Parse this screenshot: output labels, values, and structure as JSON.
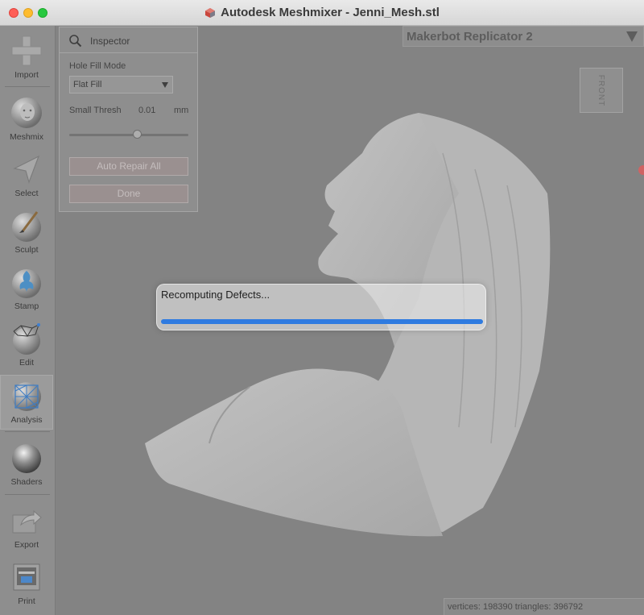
{
  "window": {
    "title": "Autodesk Meshmixer - Jenni_Mesh.stl"
  },
  "toolbar": {
    "tools": [
      {
        "label": "Import",
        "icon": "plus-icon"
      },
      {
        "label": "Meshmix",
        "icon": "head-sphere-icon"
      },
      {
        "label": "Select",
        "icon": "arrow-cursor-icon"
      },
      {
        "label": "Sculpt",
        "icon": "brush-sphere-icon"
      },
      {
        "label": "Stamp",
        "icon": "stamp-sphere-icon"
      },
      {
        "label": "Edit",
        "icon": "wireframe-sphere-icon"
      },
      {
        "label": "Analysis",
        "icon": "analysis-mesh-icon"
      },
      {
        "label": "Shaders",
        "icon": "shaded-sphere-icon"
      },
      {
        "label": "Export",
        "icon": "export-arrow-icon"
      },
      {
        "label": "Print",
        "icon": "printer-icon"
      }
    ],
    "active": "Analysis"
  },
  "printer": {
    "name": "Makerbot Replicator 2"
  },
  "viewcube": {
    "face": "FRONT"
  },
  "inspector": {
    "title": "Inspector",
    "hole_fill_mode_label": "Hole Fill Mode",
    "hole_fill_mode_value": "Flat Fill",
    "small_thresh_label": "Small Thresh",
    "small_thresh_value": "0.01",
    "small_thresh_unit": "mm",
    "slider_fraction": 0.57,
    "auto_repair_label": "Auto Repair All",
    "done_label": "Done"
  },
  "dialog": {
    "message": "Recomputing Defects...",
    "progress_fraction": 1.0
  },
  "status": {
    "text": "vertices: 198390 triangles: 396792"
  },
  "colors": {
    "viewport": "#838383",
    "progress": "#2f7be0",
    "traffic_close": "#fe5f57",
    "traffic_min": "#febc2e",
    "traffic_max": "#28c840"
  }
}
